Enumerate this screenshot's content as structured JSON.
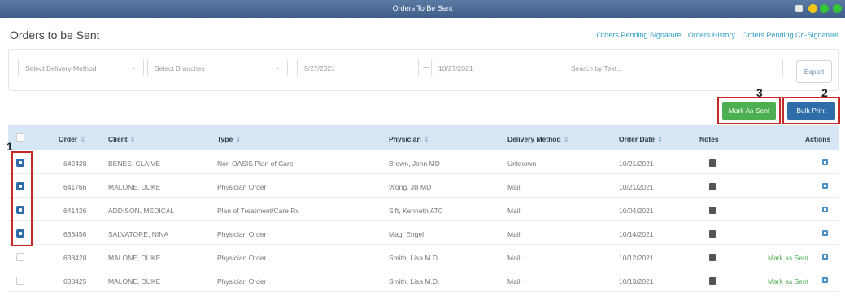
{
  "window": {
    "title": "Orders To Be Sent"
  },
  "page": {
    "title": "Orders to be Sent"
  },
  "links": [
    "Orders Pending Signature",
    "Orders History",
    "Orders Pending Co-Signature"
  ],
  "filters": {
    "delivery_method": "Select Delivery Method",
    "branches": "Select Branches",
    "date_from": "9/27/2021",
    "date_to": "10/27/2021",
    "search_placeholder": "Search by Text...",
    "export": "Export"
  },
  "actions": {
    "mark_sent": "Mark As Sent",
    "bulk_print": "Bulk Print"
  },
  "callouts": [
    "1",
    "2",
    "3"
  ],
  "table": {
    "headers": [
      "Order",
      "Client",
      "Type",
      "Physician",
      "Delivery Method",
      "Order Date",
      "Notes",
      "Actions"
    ],
    "rows": [
      {
        "checked": true,
        "order": "642428",
        "client": "BENES, CLAIVE",
        "type": "Non OASIS Plan of Care",
        "physician": "Brown, John MD",
        "delivery": "Unknown",
        "date": "10/21/2021",
        "action": ""
      },
      {
        "checked": true,
        "order": "641766",
        "client": "MALONE, DUKE",
        "type": "Physician Order",
        "physician": "Wong, JB MD",
        "delivery": "Mail",
        "date": "10/21/2021",
        "action": ""
      },
      {
        "checked": true,
        "order": "641426",
        "client": "ADDISON, MEDICAL",
        "type": "Plan of Treatment/Care Rx",
        "physician": "Sift, Kenneth ATC",
        "delivery": "Mail",
        "date": "10/04/2021",
        "action": ""
      },
      {
        "checked": true,
        "order": "638456",
        "client": "SALVATORE, NINA",
        "type": "Physician Order",
        "physician": "Mag, Engel",
        "delivery": "Mail",
        "date": "10/14/2021",
        "action": ""
      },
      {
        "checked": false,
        "order": "638428",
        "client": "MALONE, DUKE",
        "type": "Physician Order",
        "physician": "Smith, Lisa M.D.",
        "delivery": "Mail",
        "date": "10/12/2021",
        "action": "Mark as Sent"
      },
      {
        "checked": false,
        "order": "638425",
        "client": "MALONE, DUKE",
        "type": "Physician Order",
        "physician": "Smith, Lisa M.D.",
        "delivery": "Mail",
        "date": "10/13/2021",
        "action": "Mark as Sent"
      }
    ]
  }
}
